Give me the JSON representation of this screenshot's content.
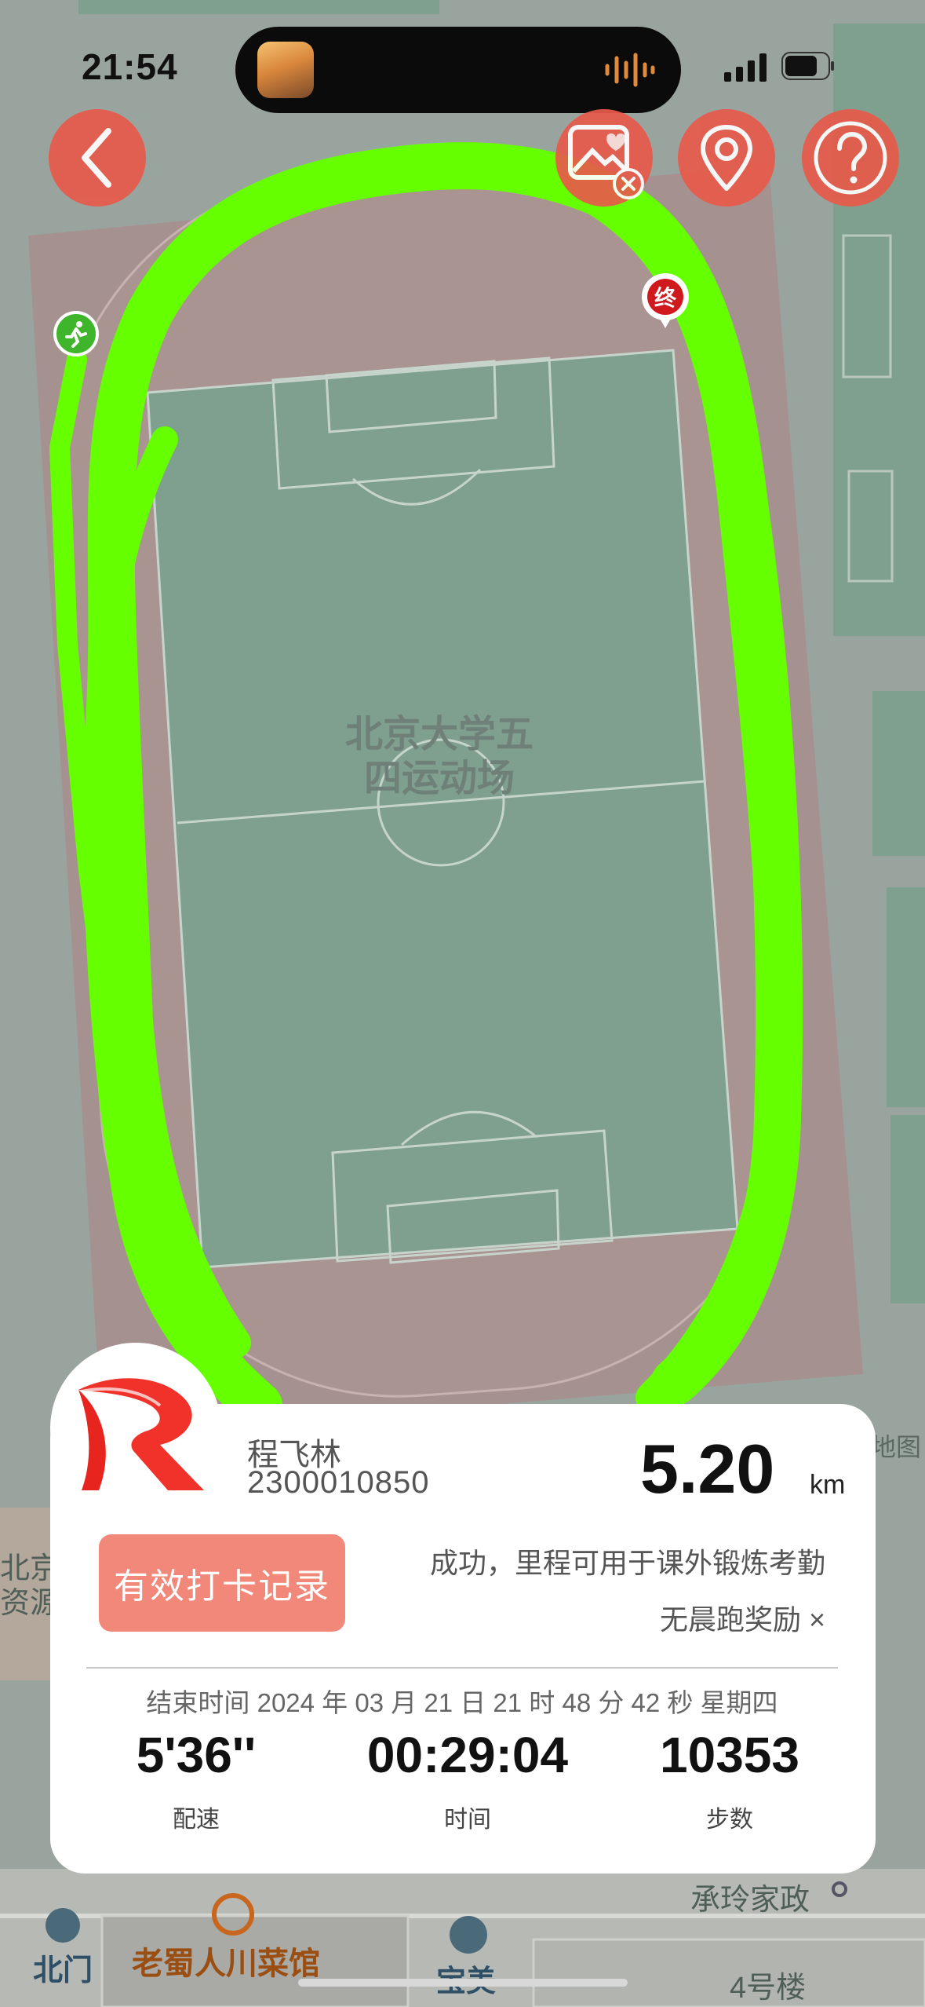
{
  "status_bar": {
    "time": "21:54"
  },
  "map": {
    "venue_label_line1": "北京大学五",
    "venue_label_line2": "四运动场",
    "start_marker_icon": "runner-icon",
    "end_marker_text": "终",
    "left_label_line1": "北京",
    "left_label_line2": "资源",
    "right_edge_label": "地图",
    "pois": {
      "north_gate": "北门",
      "restaurant": "老蜀人川菜馆",
      "salon": "宝美",
      "housekeeping": "承玲家政",
      "building": "4号楼"
    }
  },
  "toolbar": {
    "back_icon": "back-chevron-icon",
    "photo_icon": "photo-remove-icon",
    "location_icon": "location-pin-icon",
    "help_icon": "help-icon"
  },
  "card": {
    "name": "程飞林",
    "student_id": "2300010850",
    "distance": "5.20",
    "distance_unit": "km",
    "record_button": "有效打卡记录",
    "status_text": "成功，里程可用于课外锻炼考勤",
    "bonus_text": "无晨跑奖励 ×",
    "end_time": "结束时间 2024 年 03 月 21 日 21 时 48 分 42 秒 星期四",
    "pace_value": "5'36''",
    "pace_label": "配速",
    "time_value": "00:29:04",
    "time_label": "时间",
    "steps_value": "10353",
    "steps_label": "步数"
  },
  "colors": {
    "track_route": "#66ff00",
    "accent_red": "#e85a4a",
    "record_button": "#f2887a",
    "field_green": "#7fa08e",
    "running_track": "#a59290"
  }
}
